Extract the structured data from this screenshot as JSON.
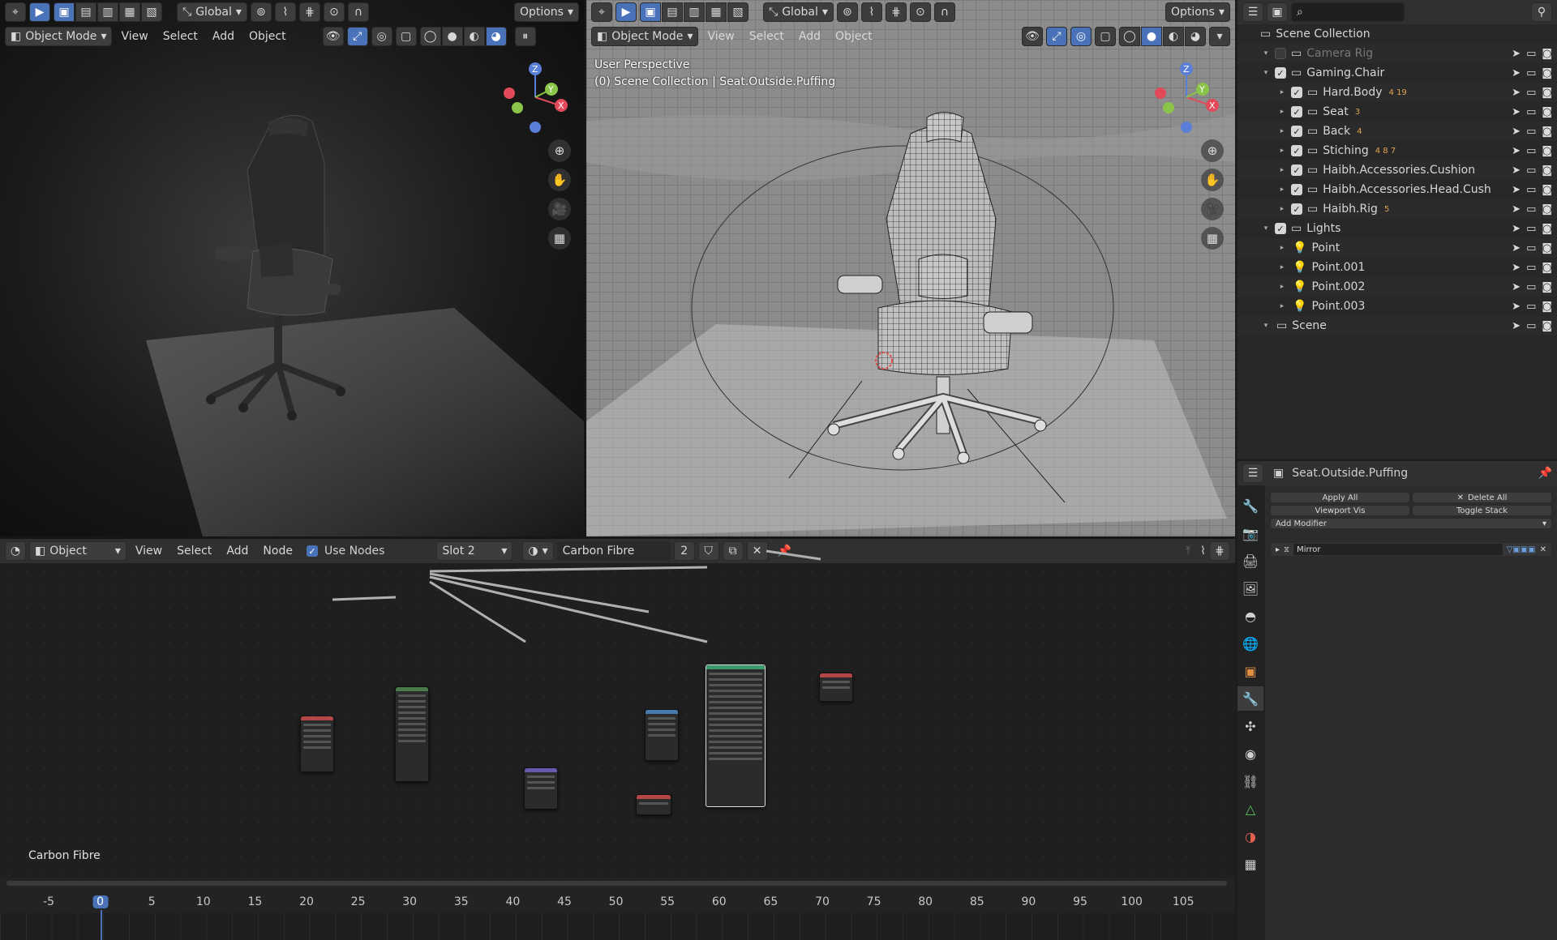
{
  "left_viewport": {
    "header": {
      "transform_label": "Global",
      "options_label": "Options",
      "mode_label": "Object Mode",
      "menus": [
        "View",
        "Select",
        "Add",
        "Object"
      ]
    }
  },
  "right_viewport": {
    "header": {
      "transform_label": "Global",
      "options_label": "Options",
      "mode_label": "Object Mode",
      "menus": [
        "View",
        "Select",
        "Add",
        "Object"
      ]
    },
    "overlay_line1": "User Perspective",
    "overlay_line2": "(0) Scene Collection | Seat.Outside.Puffing",
    "gizmo": {
      "x": "X",
      "y": "Y",
      "z": "Z"
    }
  },
  "outliner": {
    "root": "Scene Collection",
    "items": [
      {
        "label": "Camera Rig",
        "level": 1,
        "checked": false,
        "dim": true,
        "extra": ""
      },
      {
        "label": "Gaming.Chair",
        "level": 1,
        "checked": true,
        "dim": false,
        "extra": ""
      },
      {
        "label": "Hard.Body",
        "level": 2,
        "checked": true,
        "dim": false,
        "extra": "4 19"
      },
      {
        "label": "Seat",
        "level": 2,
        "checked": true,
        "dim": false,
        "extra": "3"
      },
      {
        "label": "Back",
        "level": 2,
        "checked": true,
        "dim": false,
        "extra": "4"
      },
      {
        "label": "Stiching",
        "level": 2,
        "checked": true,
        "dim": false,
        "extra": "4 8 7"
      },
      {
        "label": "Haibh.Accessories.Cushion",
        "level": 2,
        "checked": true,
        "dim": false,
        "extra": ""
      },
      {
        "label": "Haibh.Accessories.Head.Cush",
        "level": 2,
        "checked": true,
        "dim": false,
        "extra": ""
      },
      {
        "label": "Haibh.Rig",
        "level": 2,
        "checked": true,
        "dim": false,
        "extra": "5"
      },
      {
        "label": "Lights",
        "level": 1,
        "checked": true,
        "dim": false,
        "extra": ""
      },
      {
        "label": "Point",
        "level": 2,
        "checked": null,
        "dim": false,
        "extra": ""
      },
      {
        "label": "Point.001",
        "level": 2,
        "checked": null,
        "dim": false,
        "extra": ""
      },
      {
        "label": "Point.002",
        "level": 2,
        "checked": null,
        "dim": false,
        "extra": ""
      },
      {
        "label": "Point.003",
        "level": 2,
        "checked": null,
        "dim": false,
        "extra": ""
      },
      {
        "label": "Scene",
        "level": 1,
        "checked": null,
        "dim": false,
        "extra": ""
      }
    ]
  },
  "properties": {
    "object_name": "Seat.Outside.Puffing",
    "apply_all": "Apply All",
    "delete_all": "Delete All",
    "viewport_vis": "Viewport Vis",
    "toggle_stack": "Toggle Stack",
    "add_modifier": "Add Modifier",
    "modifier_name": "Mirror"
  },
  "node_editor": {
    "editor_type": "Object",
    "menus": [
      "View",
      "Select",
      "Add",
      "Node"
    ],
    "use_nodes_label": "Use Nodes",
    "slot_label": "Slot 2",
    "material_name": "Carbon Fibre",
    "users_count": "2",
    "footer_label": "Carbon Fibre"
  },
  "timeline": {
    "current_frame": "0",
    "ticks": [
      "-5",
      "0",
      "5",
      "10",
      "15",
      "20",
      "25",
      "30",
      "35",
      "40",
      "45",
      "50",
      "55",
      "60",
      "65",
      "70",
      "75",
      "80",
      "85",
      "90",
      "95",
      "100",
      "105"
    ]
  },
  "colors": {
    "accent": "#4a72b8",
    "panel": "#303030",
    "background": "#1d1d1d",
    "light_icon": "#e0a050"
  }
}
